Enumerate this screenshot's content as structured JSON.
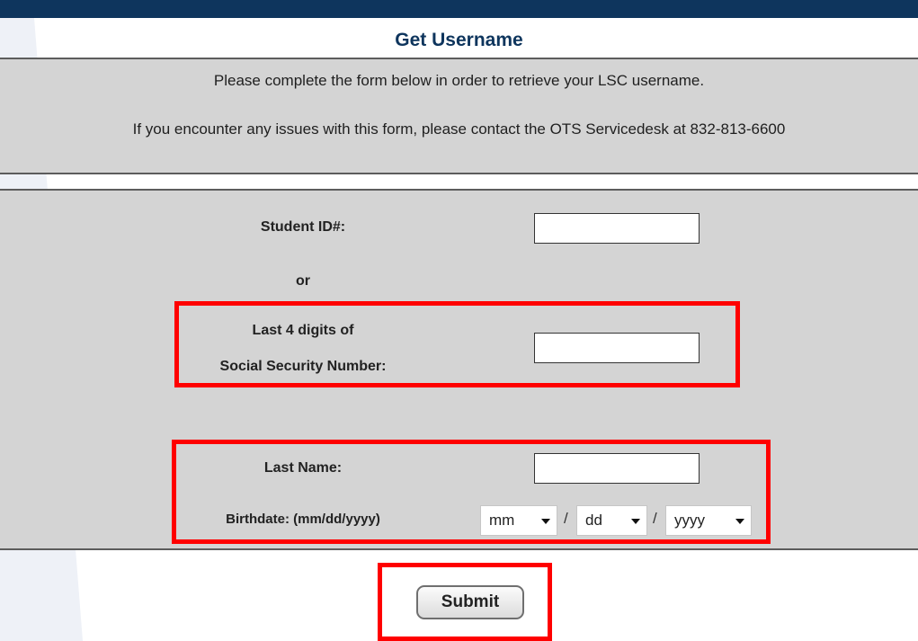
{
  "header": {
    "title": "Get Username"
  },
  "intro": {
    "line1": "Please complete the form below in order to retrieve your LSC username.",
    "line2": "If you encounter any issues with this form, please contact the OTS Servicedesk at 832-813-6600"
  },
  "form": {
    "student_id_label": "Student ID#:",
    "or_label": "or",
    "ssn_label_line1": "Last 4 digits of",
    "ssn_label_line2": "Social Security Number:",
    "last_name_label": "Last Name:",
    "birthdate_label": "Birthdate: (mm/dd/yyyy)",
    "student_id_value": "",
    "ssn_value": "",
    "last_name_value": "",
    "birth_month": "mm",
    "birth_day": "dd",
    "birth_year": "yyyy",
    "date_separator": "/"
  },
  "submit_label": "Submit",
  "colors": {
    "header_bar": "#0e355d",
    "panel_bg": "#d4d4d4",
    "highlight": "#ff0000"
  }
}
